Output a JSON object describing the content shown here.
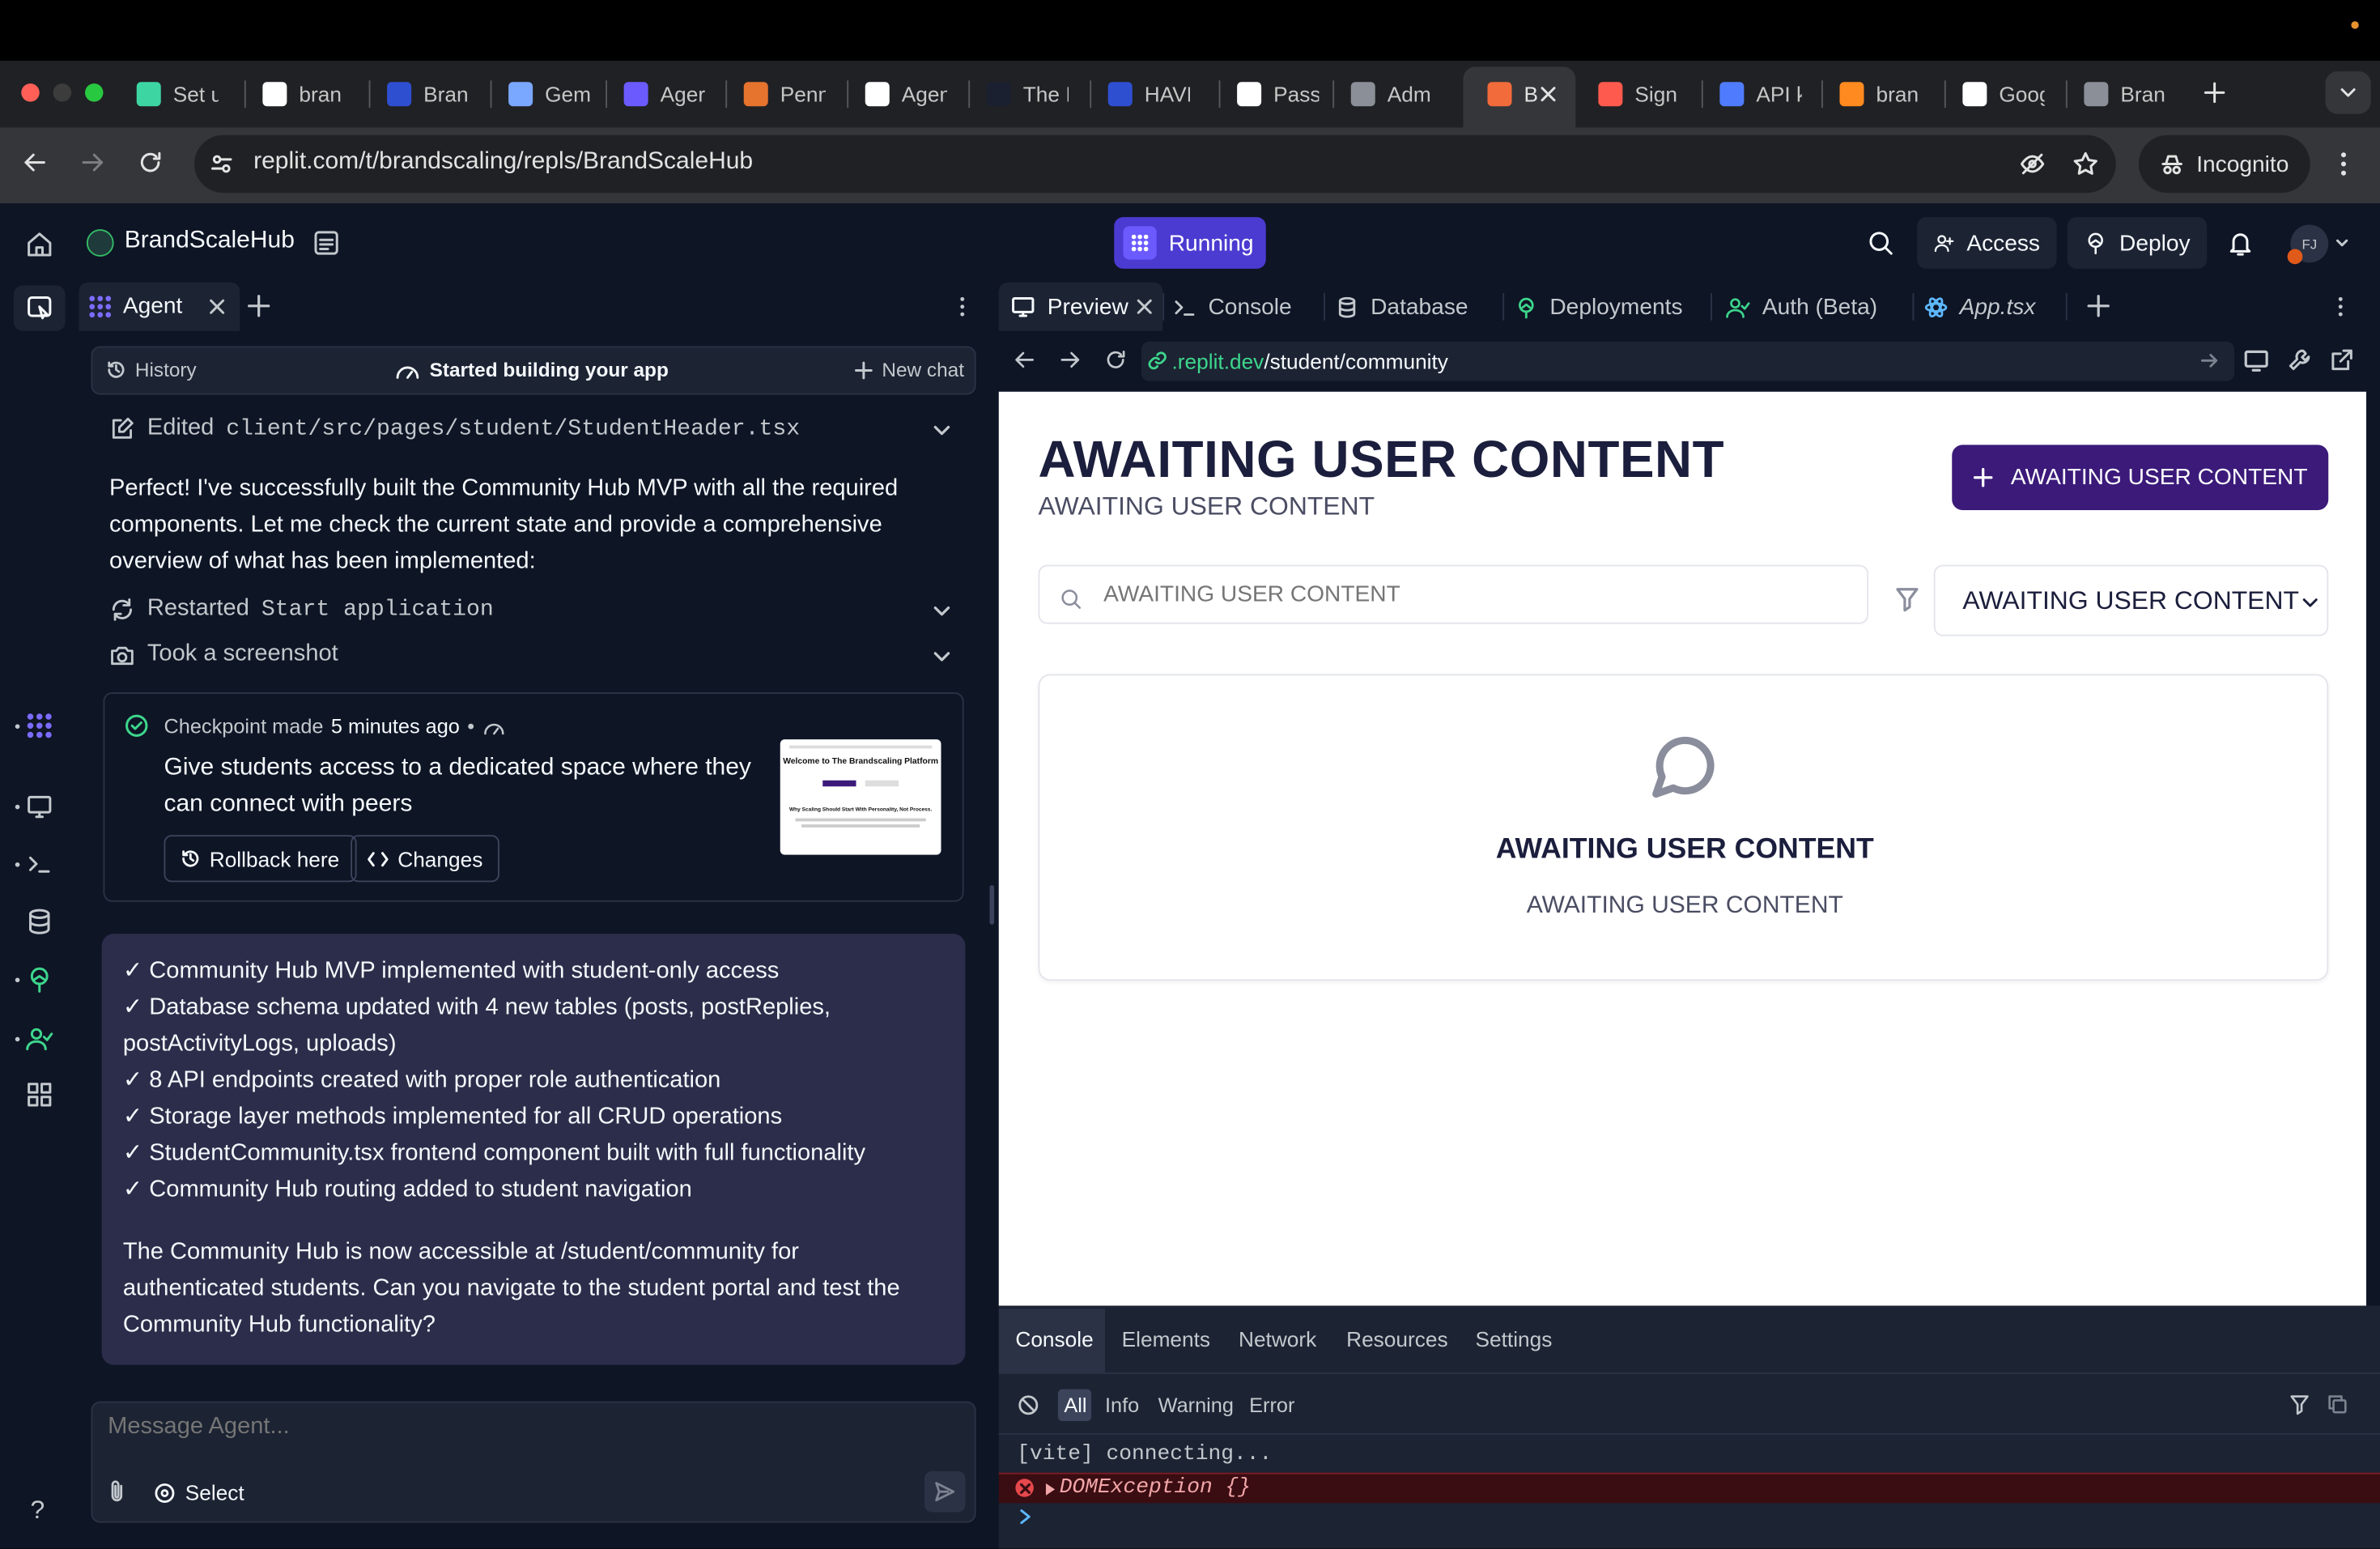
{
  "browser": {
    "tabs": [
      {
        "label": "Set u",
        "fav_color": "#3dd6a3"
      },
      {
        "label": "bran",
        "fav_color": "#ffffff"
      },
      {
        "label": "Bran",
        "fav_color": "#2f4fd1"
      },
      {
        "label": "Gem",
        "fav_color": "#7aa7ff"
      },
      {
        "label": "Ager",
        "fav_color": "#6b5bff"
      },
      {
        "label": "Penn",
        "fav_color": "#e6732e"
      },
      {
        "label": "Agen",
        "fav_color": "#ffffff"
      },
      {
        "label": "The I",
        "fav_color": "#1b2030"
      },
      {
        "label": "HAVE",
        "fav_color": "#2f4fd1"
      },
      {
        "label": "Pass",
        "fav_color": "#ffffff"
      },
      {
        "label": "Adm",
        "fav_color": "#8a8f98"
      },
      {
        "label": "B",
        "fav_color": "#f26b3a"
      },
      {
        "label": "Sign",
        "fav_color": "#ff5a4e"
      },
      {
        "label": "API k",
        "fav_color": "#4f7cff"
      },
      {
        "label": "bran",
        "fav_color": "#ff8a1f"
      },
      {
        "label": "Goog",
        "fav_color": "#ffffff"
      },
      {
        "label": "Bran",
        "fav_color": "#8a8f98"
      }
    ],
    "url": "replit.com/t/brandscaling/repls/BrandScaleHub",
    "incognito_label": "Incognito"
  },
  "header": {
    "project_name": "BrandScaleHub",
    "run_status": "Running",
    "access_label": "Access",
    "deploy_label": "Deploy",
    "avatar_initials": "FJ"
  },
  "agent": {
    "tab_label": "Agent",
    "history_label": "History",
    "status_label": "Started building your app",
    "new_chat_label": "New chat",
    "edited_prefix": "Edited",
    "edited_file": "client/src/pages/student/StudentHeader.tsx",
    "message": "Perfect! I've successfully built the Community Hub MVP with all the required components. Let me check the current state and provide a comprehensive overview of what has been implemented:",
    "restarted_prefix": "Restarted",
    "restarted_target": "Start application",
    "screenshot_label": "Took a screenshot",
    "checkpoint": {
      "made_label": "Checkpoint made",
      "time": "5 minutes ago",
      "description": "Give students access to a dedicated space where they can connect with peers",
      "rollback_label": "Rollback here",
      "changes_label": "Changes",
      "thumb_title": "Welcome to The Brandscaling Platform",
      "thumb_subtitle": "Why Scaling Should Start With Personality, Not Process."
    },
    "summary_items": [
      "✓ Community Hub MVP implemented with student-only access",
      "✓ Database schema updated with 4 new tables (posts, postReplies, postActivityLogs, uploads)",
      "✓ 8 API endpoints created with proper role authentication",
      "✓ Storage layer methods implemented for all CRUD operations",
      "✓ StudentCommunity.tsx frontend component built with full functionality",
      "✓ Community Hub routing added to student navigation"
    ],
    "summary_footer": "The Community Hub is now accessible at /student/community for authenticated students. Can you navigate to the student portal and test the Community Hub functionality?",
    "input_placeholder": "Message Agent...",
    "select_label": "Select",
    "help_label": "?"
  },
  "workspace_tabs": {
    "preview": "Preview",
    "console": "Console",
    "database": "Database",
    "deployments": "Deployments",
    "auth": "Auth (Beta)",
    "app_file": "App.tsx"
  },
  "preview": {
    "url_domain": ".replit.dev",
    "url_path": "/student/community",
    "page_title": "AWAITING USER CONTENT",
    "page_subtitle": "AWAITING USER CONTENT",
    "new_post_button": "AWAITING USER CONTENT",
    "search_placeholder": "AWAITING USER CONTENT",
    "filter_value": "AWAITING USER CONTENT",
    "empty_title": "AWAITING USER CONTENT",
    "empty_text": "AWAITING USER CONTENT",
    "accent_color": "#3b1a7a"
  },
  "devtools": {
    "tabs": [
      "Console",
      "Elements",
      "Network",
      "Resources",
      "Settings"
    ],
    "levels": [
      "All",
      "Info",
      "Warning",
      "Error"
    ],
    "log_line": "[vite] connecting...",
    "error_line": "DOMException {}"
  }
}
